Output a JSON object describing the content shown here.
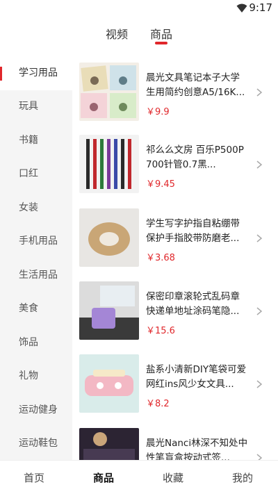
{
  "status": {
    "time": "9:17"
  },
  "top_tabs": [
    {
      "label": "视频",
      "active": false
    },
    {
      "label": "商品",
      "active": true
    }
  ],
  "accent": "#e0272b",
  "sidebar": {
    "items": [
      {
        "label": "学习用品",
        "active": true
      },
      {
        "label": "玩具"
      },
      {
        "label": "书籍"
      },
      {
        "label": "口红"
      },
      {
        "label": "女装"
      },
      {
        "label": "手机用品"
      },
      {
        "label": "生活用品"
      },
      {
        "label": "美食"
      },
      {
        "label": "饰品"
      },
      {
        "label": "礼物"
      },
      {
        "label": "运动健身"
      },
      {
        "label": "运动鞋包"
      }
    ]
  },
  "products": [
    {
      "title": "晨光文具笔记本子大学生用简约创意A5/16K...",
      "price": "￥9.9"
    },
    {
      "title": "祁么么文房 百乐P500P700针管0.7黑...",
      "price": "￥9.45"
    },
    {
      "title": "学生写字护指自粘绷带保护手指胶带防磨老...",
      "price": "￥3.68"
    },
    {
      "title": "保密印章滚轮式乱码章快递单地址涂码笔隐...",
      "price": "￥15.6"
    },
    {
      "title": "盐系小清新DIY笔袋可爱网红ins风少女文具...",
      "price": "￥8.2"
    },
    {
      "title": "晨光Nanci林深不知处中性笔盲盒按动式签...",
      "price": ""
    }
  ],
  "bottom_nav": [
    {
      "label": "首页",
      "active": false
    },
    {
      "label": "商品",
      "active": true
    },
    {
      "label": "收藏",
      "active": false
    },
    {
      "label": "我的",
      "active": false
    }
  ]
}
